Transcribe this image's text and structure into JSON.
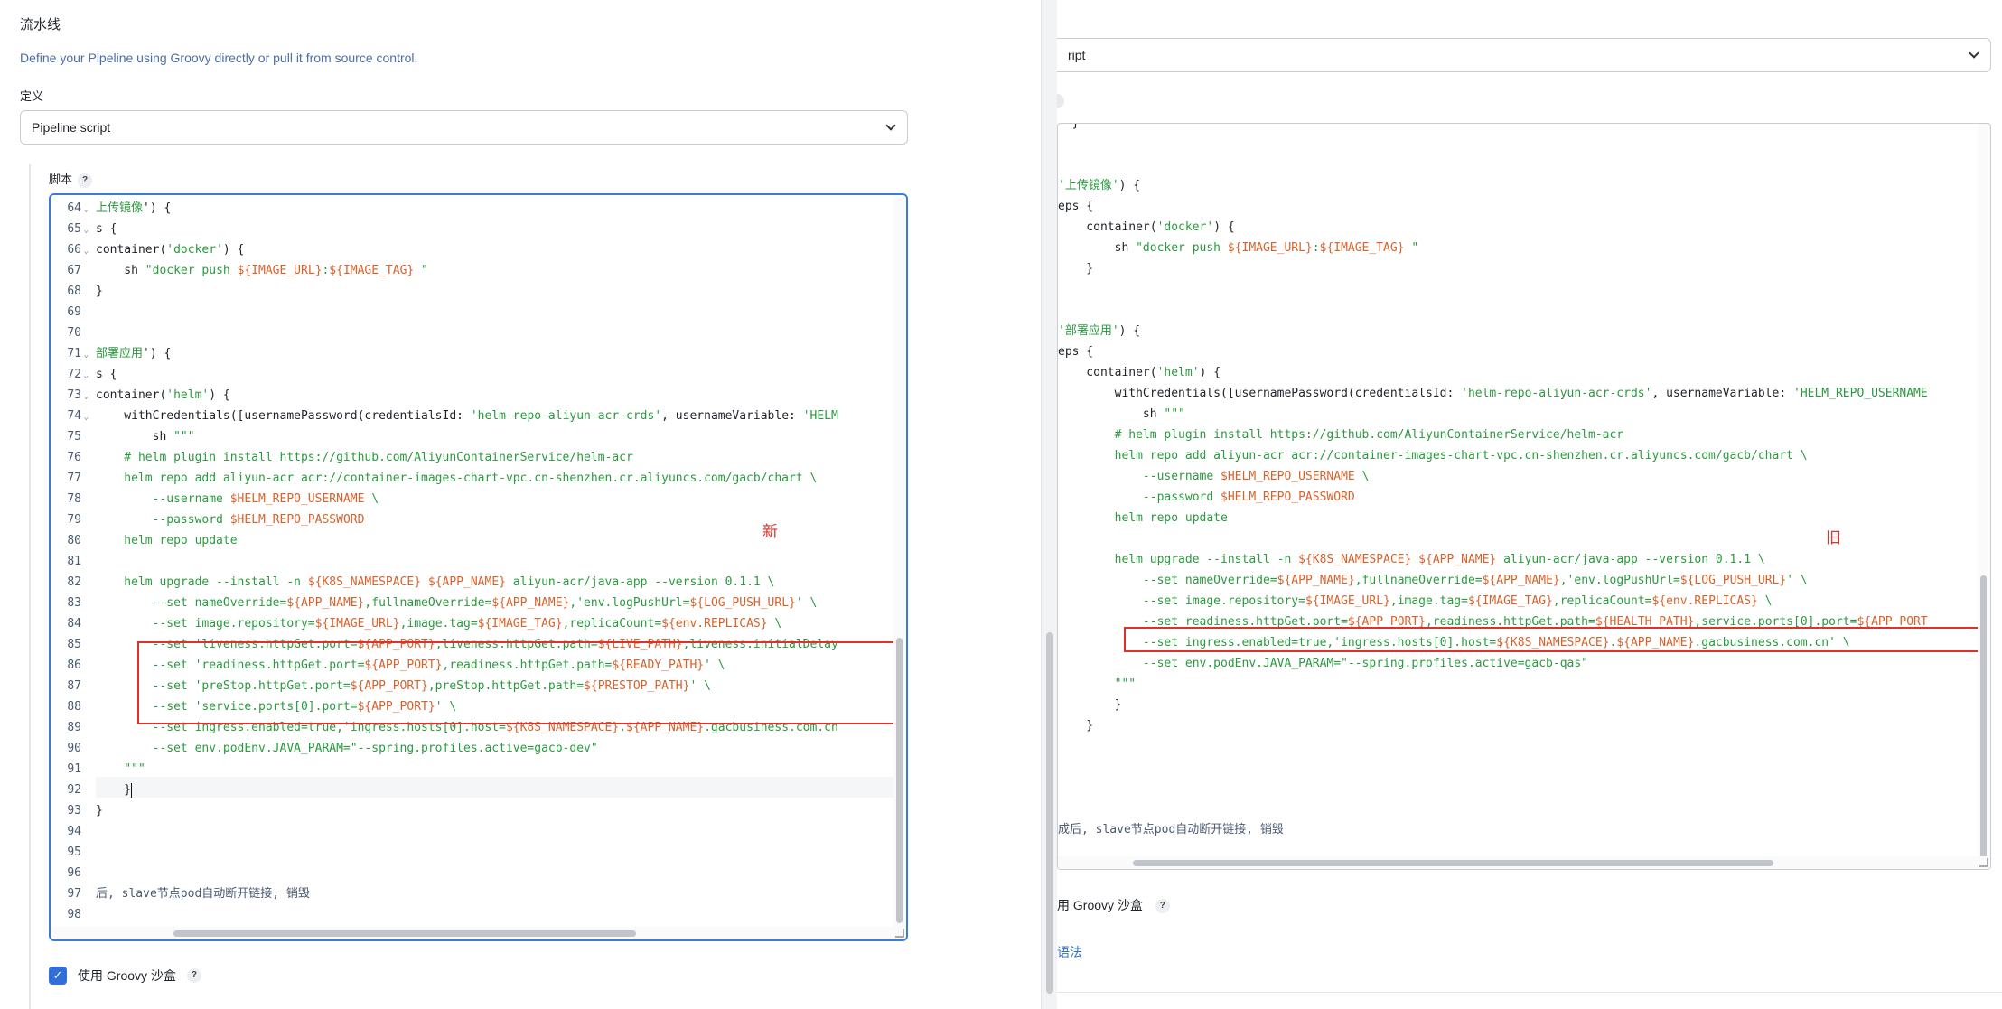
{
  "left": {
    "section_title": "流水线",
    "description": "Define your Pipeline using Groovy directly or pull it from source control.",
    "definition_label": "定义",
    "definition_value": "Pipeline script",
    "script_label": "脚本",
    "help_glyph": "?",
    "annotation": "新",
    "sandbox_label": "使用 Groovy 沙盒",
    "checkbox_glyph": "✓",
    "lines": [
      {
        "n": "64",
        "fold": true,
        "parts": [
          [
            "s",
            "上传镜像"
          ],
          [
            "k",
            "') {"
          ]
        ]
      },
      {
        "n": "65",
        "fold": true,
        "parts": [
          [
            "k",
            "s {"
          ]
        ]
      },
      {
        "n": "66",
        "fold": true,
        "parts": [
          [
            "k",
            "container("
          ],
          [
            "s",
            "'docker'"
          ],
          [
            "k",
            ") {"
          ]
        ]
      },
      {
        "n": "67",
        "fold": false,
        "parts": [
          [
            "k",
            "    sh "
          ],
          [
            "s",
            "\"docker push "
          ],
          [
            "v",
            "${IMAGE_URL}"
          ],
          [
            "s",
            ":"
          ],
          [
            "v",
            "${IMAGE_TAG}"
          ],
          [
            "s",
            " \""
          ]
        ]
      },
      {
        "n": "68",
        "fold": false,
        "parts": [
          [
            "k",
            "}"
          ]
        ]
      },
      {
        "n": "69",
        "fold": false,
        "parts": []
      },
      {
        "n": "70",
        "fold": false,
        "parts": []
      },
      {
        "n": "71",
        "fold": true,
        "parts": [
          [
            "s",
            "部署应用"
          ],
          [
            "k",
            "') {"
          ]
        ]
      },
      {
        "n": "72",
        "fold": true,
        "parts": [
          [
            "k",
            "s {"
          ]
        ]
      },
      {
        "n": "73",
        "fold": true,
        "parts": [
          [
            "k",
            "container("
          ],
          [
            "s",
            "'helm'"
          ],
          [
            "k",
            ") {"
          ]
        ]
      },
      {
        "n": "74",
        "fold": true,
        "parts": [
          [
            "k",
            "    withCredentials([usernamePassword(credentialsId: "
          ],
          [
            "s",
            "'helm-repo-aliyun-acr-crds'"
          ],
          [
            "k",
            ", usernameVariable: "
          ],
          [
            "s",
            "'HELM"
          ]
        ]
      },
      {
        "n": "75",
        "fold": false,
        "parts": [
          [
            "k",
            "        sh "
          ],
          [
            "s",
            "\"\"\""
          ]
        ]
      },
      {
        "n": "76",
        "fold": false,
        "parts": [
          [
            "s",
            "    # helm plugin install https://github.com/AliyunContainerService/helm-acr"
          ]
        ]
      },
      {
        "n": "77",
        "fold": false,
        "parts": [
          [
            "s",
            "    helm repo add aliyun-acr acr://container-images-chart-vpc.cn-shenzhen.cr.aliyuncs.com/gacb/chart \\"
          ]
        ]
      },
      {
        "n": "78",
        "fold": false,
        "parts": [
          [
            "s",
            "        --username "
          ],
          [
            "v",
            "$HELM_REPO_USERNAME"
          ],
          [
            "s",
            " \\"
          ]
        ]
      },
      {
        "n": "79",
        "fold": false,
        "parts": [
          [
            "s",
            "        --password "
          ],
          [
            "v",
            "$HELM_REPO_PASSWORD"
          ]
        ]
      },
      {
        "n": "80",
        "fold": false,
        "parts": [
          [
            "s",
            "    helm repo update"
          ]
        ]
      },
      {
        "n": "81",
        "fold": false,
        "parts": []
      },
      {
        "n": "82",
        "fold": false,
        "parts": [
          [
            "s",
            "    helm upgrade --install -n "
          ],
          [
            "v",
            "${K8S_NAMESPACE}"
          ],
          [
            "s",
            " "
          ],
          [
            "v",
            "${APP_NAME}"
          ],
          [
            "s",
            " aliyun-acr/java-app --version 0.1.1 \\"
          ]
        ]
      },
      {
        "n": "83",
        "fold": false,
        "parts": [
          [
            "s",
            "        --set nameOverride="
          ],
          [
            "v",
            "${APP_NAME}"
          ],
          [
            "s",
            ",fullnameOverride="
          ],
          [
            "v",
            "${APP_NAME}"
          ],
          [
            "s",
            ",'env.logPushUrl="
          ],
          [
            "v",
            "${LOG_PUSH_URL}"
          ],
          [
            "s",
            "' \\"
          ]
        ]
      },
      {
        "n": "84",
        "fold": false,
        "parts": [
          [
            "s",
            "        --set image.repository="
          ],
          [
            "v",
            "${IMAGE_URL}"
          ],
          [
            "s",
            ",image.tag="
          ],
          [
            "v",
            "${IMAGE_TAG}"
          ],
          [
            "s",
            ",replicaCount="
          ],
          [
            "v",
            "${env.REPLICAS}"
          ],
          [
            "s",
            " \\"
          ]
        ]
      },
      {
        "n": "85",
        "fold": false,
        "parts": [
          [
            "s",
            "        --set 'liveness.httpGet.port="
          ],
          [
            "v",
            "${APP_PORT}"
          ],
          [
            "s",
            ",liveness.httpGet.path="
          ],
          [
            "v",
            "${LIVE_PATH}"
          ],
          [
            "s",
            ",liveness.initialDelay"
          ]
        ]
      },
      {
        "n": "86",
        "fold": false,
        "parts": [
          [
            "s",
            "        --set 'readiness.httpGet.port="
          ],
          [
            "v",
            "${APP_PORT}"
          ],
          [
            "s",
            ",readiness.httpGet.path="
          ],
          [
            "v",
            "${READY_PATH}"
          ],
          [
            "s",
            "' \\"
          ]
        ]
      },
      {
        "n": "87",
        "fold": false,
        "parts": [
          [
            "s",
            "        --set 'preStop.httpGet.port="
          ],
          [
            "v",
            "${APP_PORT}"
          ],
          [
            "s",
            ",preStop.httpGet.path="
          ],
          [
            "v",
            "${PRESTOP_PATH}"
          ],
          [
            "s",
            "' \\"
          ]
        ]
      },
      {
        "n": "88",
        "fold": false,
        "parts": [
          [
            "s",
            "        --set 'service.ports[0].port="
          ],
          [
            "v",
            "${APP_PORT}"
          ],
          [
            "s",
            "' \\"
          ]
        ]
      },
      {
        "n": "89",
        "fold": false,
        "parts": [
          [
            "s",
            "        --set ingress.enabled=true,'ingress.hosts[0].host="
          ],
          [
            "v",
            "${K8S_NAMESPACE}"
          ],
          [
            "s",
            "."
          ],
          [
            "v",
            "${APP_NAME}"
          ],
          [
            "s",
            ".gacbusiness.com.cn"
          ]
        ]
      },
      {
        "n": "90",
        "fold": false,
        "parts": [
          [
            "s",
            "        --set env.podEnv.JAVA_PARAM=\"--spring.profiles.active=gacb-dev\""
          ]
        ]
      },
      {
        "n": "91",
        "fold": false,
        "parts": [
          [
            "s",
            "    \"\"\""
          ]
        ]
      },
      {
        "n": "92",
        "fold": false,
        "parts": [
          [
            "k",
            "    }"
          ]
        ]
      },
      {
        "n": "93",
        "fold": false,
        "parts": [
          [
            "k",
            "}"
          ]
        ]
      },
      {
        "n": "94",
        "fold": false,
        "parts": []
      },
      {
        "n": "95",
        "fold": false,
        "parts": []
      },
      {
        "n": "96",
        "fold": false,
        "parts": []
      },
      {
        "n": "97",
        "fold": false,
        "parts": [
          [
            "cm",
            "后, slave节点pod自动断开链接, 销毁"
          ]
        ]
      },
      {
        "n": "98",
        "fold": false,
        "parts": []
      }
    ]
  },
  "right": {
    "definition_value": "ript",
    "annotation": "旧",
    "sandbox_label": "用 Groovy 沙盒",
    "help_glyph": "?",
    "link_label": "语法",
    "lines": [
      [
        [
          "k",
          "  }"
        ]
      ],
      [],
      [],
      [
        [
          "s",
          "'上传镜像'"
        ],
        [
          "k",
          ") {"
        ]
      ],
      [
        [
          "k",
          "eps {"
        ]
      ],
      [
        [
          "k",
          "    container("
        ],
        [
          "s",
          "'docker'"
        ],
        [
          "k",
          ") {"
        ]
      ],
      [
        [
          "k",
          "        sh "
        ],
        [
          "s",
          "\"docker push "
        ],
        [
          "v",
          "${IMAGE_URL}"
        ],
        [
          "s",
          ":"
        ],
        [
          "v",
          "${IMAGE_TAG}"
        ],
        [
          "s",
          " \""
        ]
      ],
      [
        [
          "k",
          "    }"
        ]
      ],
      [],
      [],
      [
        [
          "s",
          "'部署应用'"
        ],
        [
          "k",
          ") {"
        ]
      ],
      [
        [
          "k",
          "eps {"
        ]
      ],
      [
        [
          "k",
          "    container("
        ],
        [
          "s",
          "'helm'"
        ],
        [
          "k",
          ") {"
        ]
      ],
      [
        [
          "k",
          "        withCredentials([usernamePassword(credentialsId: "
        ],
        [
          "s",
          "'helm-repo-aliyun-acr-crds'"
        ],
        [
          "k",
          ", usernameVariable: "
        ],
        [
          "s",
          "'HELM_REPO_USERNAME"
        ]
      ],
      [
        [
          "k",
          "            sh "
        ],
        [
          "s",
          "\"\"\""
        ]
      ],
      [
        [
          "s",
          "        # helm plugin install https://github.com/AliyunContainerService/helm-acr"
        ]
      ],
      [
        [
          "s",
          "        helm repo add aliyun-acr acr://container-images-chart-vpc.cn-shenzhen.cr.aliyuncs.com/gacb/chart \\"
        ]
      ],
      [
        [
          "s",
          "            --username "
        ],
        [
          "v",
          "$HELM_REPO_USERNAME"
        ],
        [
          "s",
          " \\"
        ]
      ],
      [
        [
          "s",
          "            --password "
        ],
        [
          "v",
          "$HELM_REPO_PASSWORD"
        ]
      ],
      [
        [
          "s",
          "        helm repo update"
        ]
      ],
      [],
      [
        [
          "s",
          "        helm upgrade --install -n "
        ],
        [
          "v",
          "${K8S_NAMESPACE}"
        ],
        [
          "s",
          " "
        ],
        [
          "v",
          "${APP_NAME}"
        ],
        [
          "s",
          " aliyun-acr/java-app --version 0.1.1 \\"
        ]
      ],
      [
        [
          "s",
          "            --set nameOverride="
        ],
        [
          "v",
          "${APP_NAME}"
        ],
        [
          "s",
          ",fullnameOverride="
        ],
        [
          "v",
          "${APP_NAME}"
        ],
        [
          "s",
          ",'env.logPushUrl="
        ],
        [
          "v",
          "${LOG_PUSH_URL}"
        ],
        [
          "s",
          "' \\"
        ]
      ],
      [
        [
          "s",
          "            --set image.repository="
        ],
        [
          "v",
          "${IMAGE_URL}"
        ],
        [
          "s",
          ",image.tag="
        ],
        [
          "v",
          "${IMAGE_TAG}"
        ],
        [
          "s",
          ",replicaCount="
        ],
        [
          "v",
          "${env.REPLICAS}"
        ],
        [
          "s",
          " \\"
        ]
      ],
      [
        [
          "s",
          "            --set readiness.httpGet.port="
        ],
        [
          "v",
          "${APP_PORT}"
        ],
        [
          "s",
          ",readiness.httpGet.path="
        ],
        [
          "v",
          "${HEALTH_PATH}"
        ],
        [
          "s",
          ",service.ports[0].port="
        ],
        [
          "v",
          "${APP_PORT"
        ]
      ],
      [
        [
          "s",
          "            --set ingress.enabled=true,'ingress.hosts[0].host="
        ],
        [
          "v",
          "${K8S_NAMESPACE}"
        ],
        [
          "s",
          "."
        ],
        [
          "v",
          "${APP_NAME}"
        ],
        [
          "s",
          ".gacbusiness.com.cn' \\"
        ]
      ],
      [
        [
          "s",
          "            --set env.podEnv.JAVA_PARAM=\"--spring.profiles.active=gacb-qas\""
        ]
      ],
      [
        [
          "s",
          "        \"\"\""
        ]
      ],
      [
        [
          "k",
          "        }"
        ]
      ],
      [
        [
          "k",
          "    }"
        ]
      ],
      [],
      [],
      [],
      [],
      [
        [
          "cm",
          "成后, slave节点pod自动断开链接, 销毁"
        ]
      ]
    ]
  }
}
